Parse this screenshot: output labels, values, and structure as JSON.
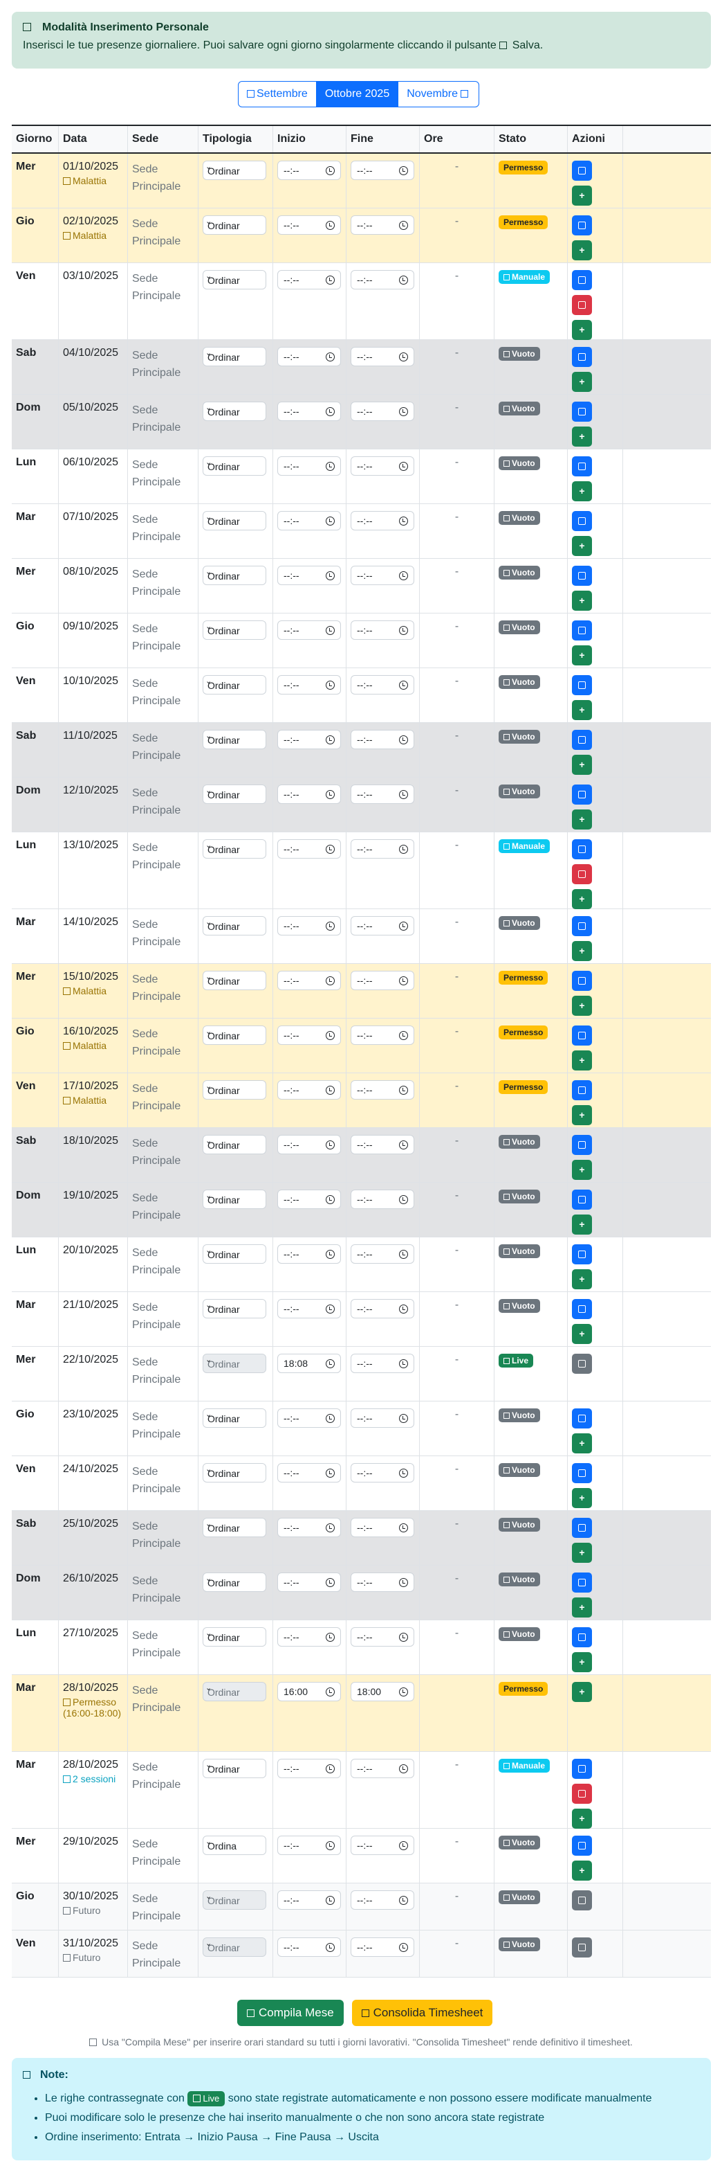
{
  "info": {
    "title": "Modalità Inserimento Personale",
    "text": "Inserisci le tue presenze giornaliere. Puoi salvare ogni giorno singolarmente cliccando il pulsante",
    "text_end": "Salva."
  },
  "month_nav": {
    "prev": "Settembre",
    "current": "Ottobre 2025",
    "next": "Novembre"
  },
  "headers": {
    "giorno": "Giorno",
    "data": "Data",
    "sede": "Sede",
    "tipologia": "Tipologia",
    "inizio": "Inizio",
    "fine": "Fine",
    "ore": "Ore",
    "stato": "Stato",
    "azioni": "Azioni"
  },
  "rows": [
    {
      "g": "Mer",
      "d": "01/10/2025",
      "sub": "Malattia",
      "sede": "Sede Principale",
      "tip": "Ordinar",
      "ini": "--:--",
      "fine": "--:--",
      "ore": "-",
      "stato": "Permesso"
    },
    {
      "g": "Gio",
      "d": "02/10/2025",
      "sub": "Malattia",
      "sede": "Sede Principale",
      "tip": "Ordinar",
      "ini": "--:--",
      "fine": "--:--",
      "ore": "-",
      "stato": "Permesso"
    },
    {
      "g": "Ven",
      "d": "03/10/2025",
      "sub": "",
      "sede": "Sede Principale",
      "tip": "Ordinar",
      "ini": "--:--",
      "fine": "--:--",
      "ore": "-",
      "stato": "Manuale"
    },
    {
      "g": "Sab",
      "d": "04/10/2025",
      "sub": "",
      "sede": "Sede Principale",
      "tip": "Ordinar",
      "ini": "--:--",
      "fine": "--:--",
      "ore": "-",
      "stato": "Vuoto"
    },
    {
      "g": "Dom",
      "d": "05/10/2025",
      "sub": "",
      "sede": "Sede Principale",
      "tip": "Ordinar",
      "ini": "--:--",
      "fine": "--:--",
      "ore": "-",
      "stato": "Vuoto"
    },
    {
      "g": "Lun",
      "d": "06/10/2025",
      "sub": "",
      "sede": "Sede Principale",
      "tip": "Ordinar",
      "ini": "--:--",
      "fine": "--:--",
      "ore": "-",
      "stato": "Vuoto"
    },
    {
      "g": "Mar",
      "d": "07/10/2025",
      "sub": "",
      "sede": "Sede Principale",
      "tip": "Ordinar",
      "ini": "--:--",
      "fine": "--:--",
      "ore": "-",
      "stato": "Vuoto"
    },
    {
      "g": "Mer",
      "d": "08/10/2025",
      "sub": "",
      "sede": "Sede Principale",
      "tip": "Ordinar",
      "ini": "--:--",
      "fine": "--:--",
      "ore": "-",
      "stato": "Vuoto"
    },
    {
      "g": "Gio",
      "d": "09/10/2025",
      "sub": "",
      "sede": "Sede Principale",
      "tip": "Ordinar",
      "ini": "--:--",
      "fine": "--:--",
      "ore": "-",
      "stato": "Vuoto"
    },
    {
      "g": "Ven",
      "d": "10/10/2025",
      "sub": "",
      "sede": "Sede Principale",
      "tip": "Ordinar",
      "ini": "--:--",
      "fine": "--:--",
      "ore": "-",
      "stato": "Vuoto"
    },
    {
      "g": "Sab",
      "d": "11/10/2025",
      "sub": "",
      "sede": "Sede Principale",
      "tip": "Ordinar",
      "ini": "--:--",
      "fine": "--:--",
      "ore": "-",
      "stato": "Vuoto"
    },
    {
      "g": "Dom",
      "d": "12/10/2025",
      "sub": "",
      "sede": "Sede Principale",
      "tip": "Ordinar",
      "ini": "--:--",
      "fine": "--:--",
      "ore": "-",
      "stato": "Vuoto"
    },
    {
      "g": "Lun",
      "d": "13/10/2025",
      "sub": "",
      "sede": "Sede Principale",
      "tip": "Ordinar",
      "ini": "--:--",
      "fine": "--:--",
      "ore": "-",
      "stato": "Manuale"
    },
    {
      "g": "Mar",
      "d": "14/10/2025",
      "sub": "",
      "sede": "Sede Principale",
      "tip": "Ordinar",
      "ini": "--:--",
      "fine": "--:--",
      "ore": "-",
      "stato": "Vuoto"
    },
    {
      "g": "Mer",
      "d": "15/10/2025",
      "sub": "Malattia",
      "sede": "Sede Principale",
      "tip": "Ordinar",
      "ini": "--:--",
      "fine": "--:--",
      "ore": "-",
      "stato": "Permesso"
    },
    {
      "g": "Gio",
      "d": "16/10/2025",
      "sub": "Malattia",
      "sede": "Sede Principale",
      "tip": "Ordinar",
      "ini": "--:--",
      "fine": "--:--",
      "ore": "-",
      "stato": "Permesso"
    },
    {
      "g": "Ven",
      "d": "17/10/2025",
      "sub": "Malattia",
      "sede": "Sede Principale",
      "tip": "Ordinar",
      "ini": "--:--",
      "fine": "--:--",
      "ore": "-",
      "stato": "Permesso"
    },
    {
      "g": "Sab",
      "d": "18/10/2025",
      "sub": "",
      "sede": "Sede Principale",
      "tip": "Ordinar",
      "ini": "--:--",
      "fine": "--:--",
      "ore": "-",
      "stato": "Vuoto"
    },
    {
      "g": "Dom",
      "d": "19/10/2025",
      "sub": "",
      "sede": "Sede Principale",
      "tip": "Ordinar",
      "ini": "--:--",
      "fine": "--:--",
      "ore": "-",
      "stato": "Vuoto"
    },
    {
      "g": "Lun",
      "d": "20/10/2025",
      "sub": "",
      "sede": "Sede Principale",
      "tip": "Ordinar",
      "ini": "--:--",
      "fine": "--:--",
      "ore": "-",
      "stato": "Vuoto"
    },
    {
      "g": "Mar",
      "d": "21/10/2025",
      "sub": "",
      "sede": "Sede Principale",
      "tip": "Ordinar",
      "ini": "--:--",
      "fine": "--:--",
      "ore": "-",
      "stato": "Vuoto"
    },
    {
      "g": "Mer",
      "d": "22/10/2025",
      "sub": "",
      "sede": "Sede Principale",
      "tip": "Ordinar",
      "ini": "18:08",
      "fine": "--:--",
      "ore": "-",
      "stato": "Live"
    },
    {
      "g": "Gio",
      "d": "23/10/2025",
      "sub": "",
      "sede": "Sede Principale",
      "tip": "Ordinar",
      "ini": "--:--",
      "fine": "--:--",
      "ore": "-",
      "stato": "Vuoto"
    },
    {
      "g": "Ven",
      "d": "24/10/2025",
      "sub": "",
      "sede": "Sede Principale",
      "tip": "Ordinar",
      "ini": "--:--",
      "fine": "--:--",
      "ore": "-",
      "stato": "Vuoto"
    },
    {
      "g": "Sab",
      "d": "25/10/2025",
      "sub": "",
      "sede": "Sede Principale",
      "tip": "Ordinar",
      "ini": "--:--",
      "fine": "--:--",
      "ore": "-",
      "stato": "Vuoto"
    },
    {
      "g": "Dom",
      "d": "26/10/2025",
      "sub": "",
      "sede": "Sede Principale",
      "tip": "Ordinar",
      "ini": "--:--",
      "fine": "--:--",
      "ore": "-",
      "stato": "Vuoto"
    },
    {
      "g": "Lun",
      "d": "27/10/2025",
      "sub": "",
      "sede": "Sede Principale",
      "tip": "Ordinar",
      "ini": "--:--",
      "fine": "--:--",
      "ore": "-",
      "stato": "Vuoto"
    },
    {
      "g": "Mar",
      "d": "28/10/2025",
      "sub": "Permesso (16:00-18:00)",
      "sede": "Sede Principale",
      "tip": "Ordinar",
      "ini": "16:00",
      "fine": "18:00",
      "ore": "",
      "stato": "Permesso"
    },
    {
      "g": "Mar",
      "d": "28/10/2025",
      "sub": "2 sessioni",
      "sede": "Sede Principale",
      "tip": "Ordinar",
      "ini": "--:--",
      "fine": "--:--",
      "ore": "-",
      "stato": "Manuale"
    },
    {
      "g": "Mer",
      "d": "29/10/2025",
      "sub": "",
      "sede": "Sede Principale",
      "tip": "Ordina",
      "ini": "--:--",
      "fine": "--:--",
      "ore": "-",
      "stato": "Vuoto"
    },
    {
      "g": "Gio",
      "d": "30/10/2025",
      "sub": "Futuro",
      "sede": "Sede Principale",
      "tip": "Ordinar",
      "ini": "--:--",
      "fine": "--:--",
      "ore": "-",
      "stato": "Vuoto"
    },
    {
      "g": "Ven",
      "d": "31/10/2025",
      "sub": "Futuro",
      "sede": "Sede Principale",
      "tip": "Ordinar",
      "ini": "--:--",
      "fine": "--:--",
      "ore": "-",
      "stato": "Vuoto"
    }
  ],
  "footer": {
    "compila": "Compila Mese",
    "consolida": "Consolida Timesheet",
    "hint": "Usa \"Compila Mese\" per inserire orari standard su tutti i giorni lavorativi. \"Consolida Timesheet\" rende definitivo il timesheet."
  },
  "notes": {
    "title": "Note:",
    "item1_a": "Le righe contrassegnate con",
    "item1_badge": "Live",
    "item1_b": "sono state registrate automaticamente e non possono essere modificate manualmente",
    "item2": "Puoi modificare solo le presenze che hai inserito manualmente o che non sono ancora state registrate",
    "item3": "Ordine inserimento: Entrata → Inizio Pausa → Fine Pausa → Uscita"
  },
  "colors": {
    "primary": "#0d6efd",
    "success": "#198754",
    "warning": "#ffc107",
    "info": "#0dcaf0",
    "danger": "#dc3545",
    "secondary": "#6c757d"
  }
}
